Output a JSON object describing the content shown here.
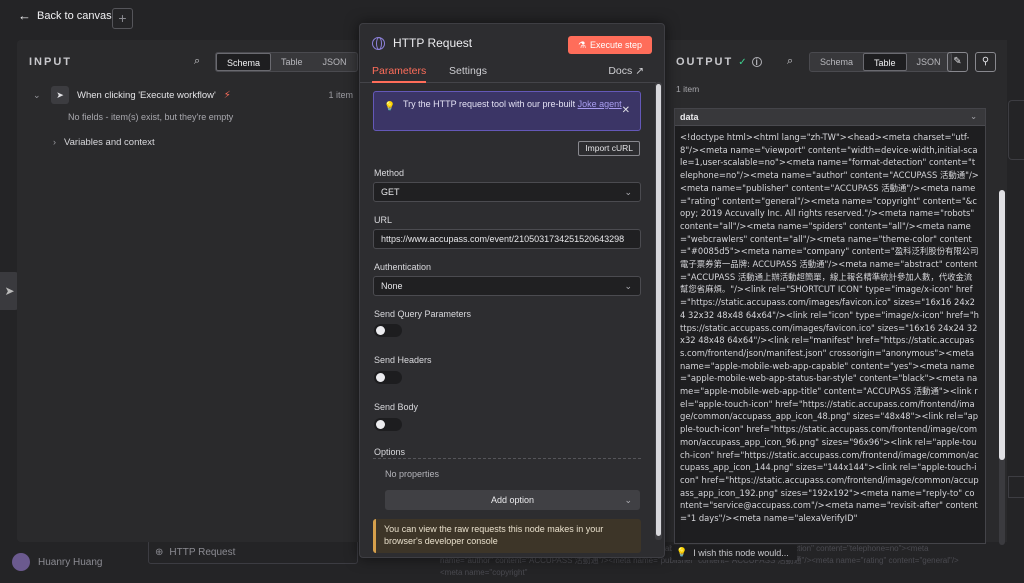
{
  "background": {
    "back_label": "Back to canvas",
    "plus_label": "+",
    "bottom_node_label": "HTTP Request",
    "user_name": "Huanry Huang",
    "bg_text": "\"viewport\" content=\"width=device-width,initial-scale=1,user-scalable=no\"><meta name=\"format-detection\" content=\"telephone=no\"><meta name=\"author\" content=\"ACCUPASS 活動通\"/><meta name=\"publisher\" content=\"ACCUPASS 活動通\"/><meta name=\"rating\" content=\"general\"/><meta name=\"copyright\""
  },
  "input": {
    "title": "INPUT",
    "views": [
      "Schema",
      "Table",
      "JSON"
    ],
    "active_view": "Schema",
    "trigger_label": "When clicking 'Execute workflow'",
    "trigger_count": "1 item",
    "no_fields": "No fields - item(s) exist, but they're empty",
    "variables_label": "Variables and context"
  },
  "node": {
    "title": "HTTP Request",
    "execute_label": "Execute step",
    "tabs": [
      "Parameters",
      "Settings"
    ],
    "docs_label": "Docs",
    "notice_text": "Try the HTTP request tool with our pre-built ",
    "notice_link": "Joke agent",
    "import_label": "Import cURL",
    "method_label": "Method",
    "method_value": "GET",
    "url_label": "URL",
    "url_value": "https://www.accupass.com/event/2105031734251520643298",
    "auth_label": "Authentication",
    "auth_value": "None",
    "send_query_label": "Send Query Parameters",
    "send_headers_label": "Send Headers",
    "send_body_label": "Send Body",
    "toggles": {
      "send_query": false,
      "send_headers": false,
      "send_body": false
    },
    "options_label": "Options",
    "no_properties": "No properties",
    "add_option_label": "Add option",
    "warning_text": "You can view the raw requests this node makes in your browser's developer console"
  },
  "output": {
    "title": "OUTPUT",
    "views": [
      "Schema",
      "Table",
      "JSON"
    ],
    "active_view": "Table",
    "items_count": "1 item",
    "column_header": "data",
    "data_text": "<!doctype html><html lang=\"zh-TW\"><head><meta charset=\"utf-8\"/><meta name=\"viewport\" content=\"width=device-width,initial-scale=1,user-scalable=no\"><meta name=\"format-detection\" content=\"telephone=no\"/><meta name=\"author\" content=\"ACCUPASS 活動通\"/><meta name=\"publisher\" content=\"ACCUPASS 活動通\"/><meta name=\"rating\" content=\"general\"/><meta name=\"copyright\" content=\"&copy; 2019 Accuvally Inc. All rights reserved.\"/><meta name=\"robots\" content=\"all\"/><meta name=\"spiders\" content=\"all\"/><meta name=\"webcrawlers\" content=\"all\"/><meta name=\"theme-color\" content=\"#0085d5\"><meta name=\"company\" content=\"盈科泛利股份有限公司電子票券第一品牌: ACCUPASS 活動通\"/><meta name=\"abstract\" content=\"ACCUPASS 活動通上辦活動超簡單，線上報名精準統計參加人數，代收金流幫您省麻煩。\"/><link rel=\"SHORTCUT ICON\" type=\"image/x-icon\" href=\"https://static.accupass.com/images/favicon.ico\" sizes=\"16x16 24x24 32x32 48x48 64x64\"/><link rel=\"icon\" type=\"image/x-icon\" href=\"https://static.accupass.com/images/favicon.ico\" sizes=\"16x16 24x24 32x32 48x48 64x64\"/><link rel=\"manifest\" href=\"https://static.accupass.com/frontend/json/manifest.json\" crossorigin=\"anonymous\"><meta name=\"apple-mobile-web-app-capable\" content=\"yes\"><meta name=\"apple-mobile-web-app-status-bar-style\" content=\"black\"><meta name=\"apple-mobile-web-app-title\" content=\"ACCUPASS 活動通\"><link rel=\"apple-touch-icon\" href=\"https://static.accupass.com/frontend/image/common/accupass_app_icon_48.png\" sizes=\"48x48\"><link rel=\"apple-touch-icon\" href=\"https://static.accupass.com/frontend/image/common/accupass_app_icon_96.png\" sizes=\"96x96\"><link rel=\"apple-touch-icon\" href=\"https://static.accupass.com/frontend/image/common/accupass_app_icon_144.png\" sizes=\"144x144\"><link rel=\"apple-touch-icon\" href=\"https://static.accupass.com/frontend/image/common/accupass_app_icon_192.png\" sizes=\"192x192\"><meta name=\"reply-to\" content=\"service@accupass.com\"/><meta name=\"revisit-after\" content=\"1 days\"/><meta name=\"alexaVerifyID\"",
    "feedback_label": "I wish this node would..."
  },
  "colors": {
    "accent": "#ff6d5a",
    "success": "#3ecf8e",
    "notice_bg": "#3b3566",
    "warning_border": "#d6a04c"
  }
}
